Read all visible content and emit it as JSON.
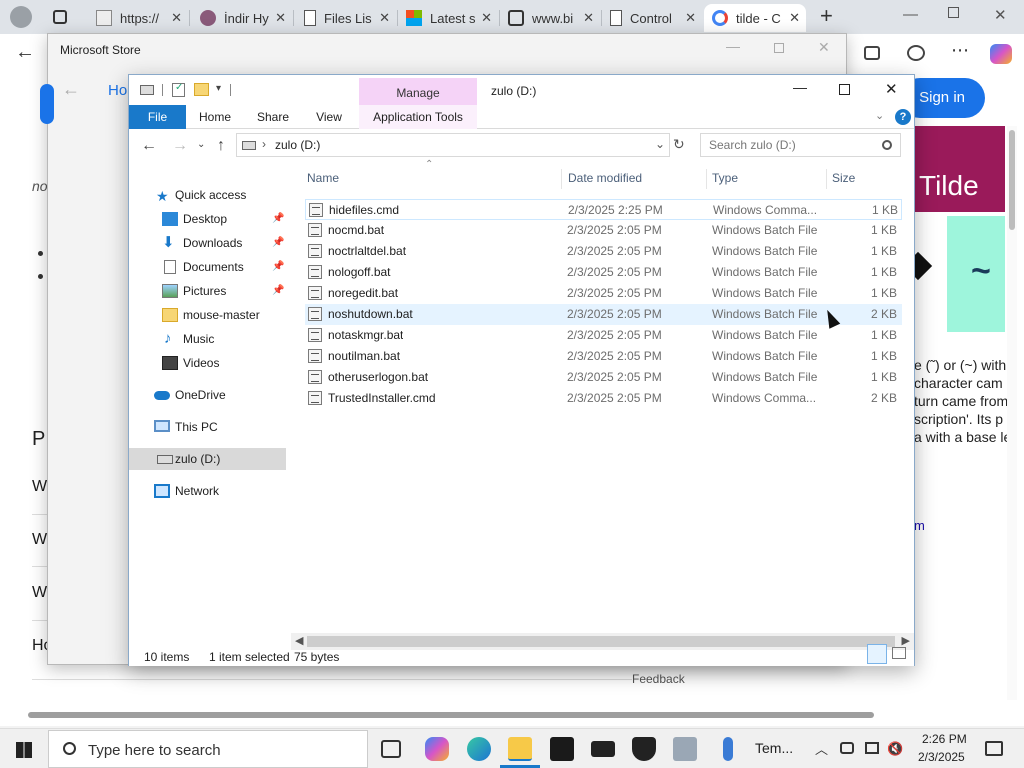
{
  "browser": {
    "tabs": [
      {
        "label": "https://",
        "icon": "page-icon"
      },
      {
        "label": "İndir Hy",
        "icon": "shield-icon"
      },
      {
        "label": "Files Lis",
        "icon": "document-icon"
      },
      {
        "label": "Latest s",
        "icon": "windows-icon"
      },
      {
        "label": "www.bi",
        "icon": "network-icon"
      },
      {
        "label": "Control",
        "icon": "document-icon"
      },
      {
        "label": "tilde - C",
        "icon": "google-icon"
      }
    ],
    "new_tab": "+",
    "signin": "Sign in",
    "page": {
      "tilde_word": "Tilde",
      "tilde_glyph": "~",
      "frag_left_no": "no",
      "frag_left_p": "P",
      "frag_left_w": "W",
      "frag_left_h": "Ho",
      "para_lines": [
        "e (˜) or (~) with",
        "character cam",
        "turn came from",
        "scription'. Its p",
        "a with a base le"
      ],
      "link_m": "m",
      "feedback": "Feedback"
    }
  },
  "store": {
    "title": "Microsoft Store",
    "back_label": "Ho"
  },
  "explorer": {
    "title": "zulo (D:)",
    "manage_label": "Manage",
    "ribbon_tabs": [
      "File",
      "Home",
      "Share",
      "View",
      "Application Tools"
    ],
    "address": "zulo (D:)",
    "search_placeholder": "Search zulo (D:)",
    "nav": {
      "quick_access": "Quick access",
      "items": [
        {
          "label": "Desktop",
          "pinned": true,
          "icon": "desktop-icon"
        },
        {
          "label": "Downloads",
          "pinned": true,
          "icon": "downloads-icon"
        },
        {
          "label": "Documents",
          "pinned": true,
          "icon": "documents-icon"
        },
        {
          "label": "Pictures",
          "pinned": true,
          "icon": "pictures-icon"
        },
        {
          "label": "mouse-master",
          "pinned": false,
          "icon": "folder-icon"
        },
        {
          "label": "Music",
          "pinned": false,
          "icon": "music-icon"
        },
        {
          "label": "Videos",
          "pinned": false,
          "icon": "videos-icon"
        }
      ],
      "onedrive": "OneDrive",
      "this_pc": "This PC",
      "drive": "zulo (D:)",
      "network": "Network"
    },
    "columns": {
      "name": "Name",
      "date": "Date modified",
      "type": "Type",
      "size": "Size"
    },
    "files": [
      {
        "name": "hidefiles.cmd",
        "date": "2/3/2025 2:25 PM",
        "type": "Windows Comma...",
        "size": "1 KB"
      },
      {
        "name": "nocmd.bat",
        "date": "2/3/2025 2:05 PM",
        "type": "Windows Batch File",
        "size": "1 KB"
      },
      {
        "name": "noctrlaltdel.bat",
        "date": "2/3/2025 2:05 PM",
        "type": "Windows Batch File",
        "size": "1 KB"
      },
      {
        "name": "nologoff.bat",
        "date": "2/3/2025 2:05 PM",
        "type": "Windows Batch File",
        "size": "1 KB"
      },
      {
        "name": "noregedit.bat",
        "date": "2/3/2025 2:05 PM",
        "type": "Windows Batch File",
        "size": "1 KB"
      },
      {
        "name": "noshutdown.bat",
        "date": "2/3/2025 2:05 PM",
        "type": "Windows Batch File",
        "size": "2 KB"
      },
      {
        "name": "notaskmgr.bat",
        "date": "2/3/2025 2:05 PM",
        "type": "Windows Batch File",
        "size": "1 KB"
      },
      {
        "name": "noutilman.bat",
        "date": "2/3/2025 2:05 PM",
        "type": "Windows Batch File",
        "size": "1 KB"
      },
      {
        "name": "otheruserlogon.bat",
        "date": "2/3/2025 2:05 PM",
        "type": "Windows Batch File",
        "size": "1 KB"
      },
      {
        "name": "TrustedInstaller.cmd",
        "date": "2/3/2025 2:05 PM",
        "type": "Windows Comma...",
        "size": "2 KB"
      }
    ],
    "status": {
      "count": "10 items",
      "selected": "1 item selected",
      "size": "75 bytes"
    }
  },
  "taskbar": {
    "search_placeholder": "Type here to search",
    "weather": "Tem...",
    "time": "2:26 PM",
    "date": "2/3/2025"
  },
  "colors": {
    "accent": "#0f6cbd",
    "manage_bg": "#f5d3f7",
    "file_tab": "#1979ca",
    "selection": "#cde8ff"
  }
}
